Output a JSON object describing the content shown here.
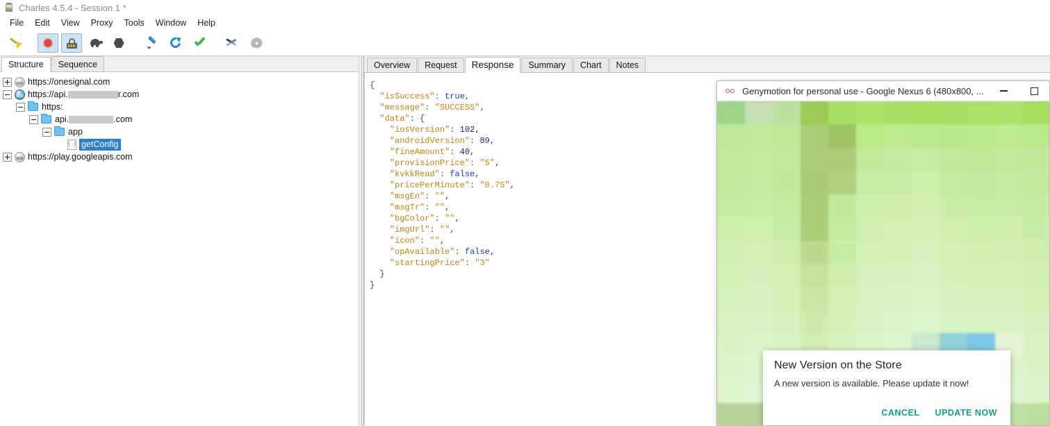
{
  "window": {
    "title": "Charles 4.5.4 - Session 1 *",
    "app_icon": "charles-jar-icon"
  },
  "menubar": {
    "items": [
      {
        "label": "File"
      },
      {
        "label": "Edit"
      },
      {
        "label": "View"
      },
      {
        "label": "Proxy"
      },
      {
        "label": "Tools"
      },
      {
        "label": "Window"
      },
      {
        "label": "Help"
      }
    ]
  },
  "toolbar": {
    "buttons": [
      {
        "name": "clear-session",
        "icon": "broom-icon",
        "active": false
      },
      {
        "name": "start-stop-recording",
        "icon": "record-icon",
        "active": true
      },
      {
        "name": "ssl-proxying",
        "icon": "lock-icon",
        "active": true
      },
      {
        "name": "throttle",
        "icon": "turtle-icon",
        "active": false
      },
      {
        "name": "breakpoints",
        "icon": "hexagon-icon",
        "active": false
      },
      {
        "name": "compose",
        "icon": "pen-icon",
        "active": false
      },
      {
        "name": "repeat",
        "icon": "refresh-icon",
        "active": false
      },
      {
        "name": "validate",
        "icon": "checkmark-icon",
        "active": false
      },
      {
        "name": "tools",
        "icon": "tools-icon",
        "active": false
      },
      {
        "name": "settings",
        "icon": "gear-icon",
        "active": false
      }
    ]
  },
  "left_pane": {
    "tabs": [
      {
        "label": "Structure",
        "active": true
      },
      {
        "label": "Sequence",
        "active": false
      }
    ],
    "tree": [
      {
        "id": "onesignal",
        "indent": 0,
        "expander": "collapsed",
        "icon": "globe-icon",
        "label": "https://onesignal.com",
        "selected": false
      },
      {
        "id": "api-host",
        "indent": 0,
        "expander": "expanded",
        "icon": "globe-blue-icon",
        "label_prefix": "https://api.",
        "redacted": true,
        "redact_width": 72,
        "label_suffix": "r.com",
        "selected": false
      },
      {
        "id": "https-folder",
        "indent": 1,
        "expander": "expanded",
        "icon": "folder-icon",
        "label": "https:",
        "selected": false
      },
      {
        "id": "api-folder",
        "indent": 2,
        "expander": "expanded",
        "icon": "folder-icon",
        "label_prefix": "api.",
        "redacted": true,
        "redact_width": 64,
        "label_suffix": ".com",
        "selected": false
      },
      {
        "id": "app-folder",
        "indent": 3,
        "expander": "expanded",
        "icon": "folder-icon",
        "label": "app",
        "selected": false
      },
      {
        "id": "getconfig",
        "indent": 4,
        "expander": "none",
        "icon": "json-file-icon",
        "label": "getConfig",
        "selected": true
      },
      {
        "id": "play-googleapis",
        "indent": 0,
        "expander": "collapsed",
        "icon": "globe-icon",
        "label": "https://play.googleapis.com",
        "selected": false
      }
    ]
  },
  "right_pane": {
    "tabs": [
      {
        "label": "Overview",
        "active": false
      },
      {
        "label": "Request",
        "active": false
      },
      {
        "label": "Response",
        "active": true
      },
      {
        "label": "Summary",
        "active": false
      },
      {
        "label": "Chart",
        "active": false
      },
      {
        "label": "Notes",
        "active": false
      }
    ],
    "response_json": [
      {
        "indent": 0,
        "parts": [
          {
            "t": "punc",
            "v": "{"
          }
        ]
      },
      {
        "indent": 1,
        "parts": [
          {
            "t": "key",
            "v": "\"isSuccess\""
          },
          {
            "t": "punc",
            "v": ": "
          },
          {
            "t": "bool",
            "v": "true"
          },
          {
            "t": "punc",
            "v": ","
          }
        ]
      },
      {
        "indent": 1,
        "parts": [
          {
            "t": "key",
            "v": "\"message\""
          },
          {
            "t": "punc",
            "v": ": "
          },
          {
            "t": "str",
            "v": "\"SUCCESS\""
          },
          {
            "t": "punc",
            "v": ","
          }
        ]
      },
      {
        "indent": 1,
        "parts": [
          {
            "t": "key",
            "v": "\"data\""
          },
          {
            "t": "punc",
            "v": ": {"
          }
        ]
      },
      {
        "indent": 2,
        "parts": [
          {
            "t": "key",
            "v": "\"iosVersion\""
          },
          {
            "t": "punc",
            "v": ": "
          },
          {
            "t": "num",
            "v": "102"
          },
          {
            "t": "punc",
            "v": ","
          }
        ]
      },
      {
        "indent": 2,
        "parts": [
          {
            "t": "key",
            "v": "\"androidVersion\""
          },
          {
            "t": "punc",
            "v": ": "
          },
          {
            "t": "num",
            "v": "89"
          },
          {
            "t": "punc",
            "v": ","
          }
        ]
      },
      {
        "indent": 2,
        "parts": [
          {
            "t": "key",
            "v": "\"fineAmount\""
          },
          {
            "t": "punc",
            "v": ": "
          },
          {
            "t": "num",
            "v": "40"
          },
          {
            "t": "punc",
            "v": ","
          }
        ]
      },
      {
        "indent": 2,
        "parts": [
          {
            "t": "key",
            "v": "\"provisionPrice\""
          },
          {
            "t": "punc",
            "v": ": "
          },
          {
            "t": "str",
            "v": "\"5\""
          },
          {
            "t": "punc",
            "v": ","
          }
        ]
      },
      {
        "indent": 2,
        "parts": [
          {
            "t": "key",
            "v": "\"kvkkRead\""
          },
          {
            "t": "punc",
            "v": ": "
          },
          {
            "t": "bool",
            "v": "false"
          },
          {
            "t": "punc",
            "v": ","
          }
        ]
      },
      {
        "indent": 2,
        "parts": [
          {
            "t": "key",
            "v": "\"pricePerMinute\""
          },
          {
            "t": "punc",
            "v": ": "
          },
          {
            "t": "str",
            "v": "\"0.75\""
          },
          {
            "t": "punc",
            "v": ","
          }
        ]
      },
      {
        "indent": 2,
        "parts": [
          {
            "t": "key",
            "v": "\"msgEn\""
          },
          {
            "t": "punc",
            "v": ": "
          },
          {
            "t": "str",
            "v": "\"\""
          },
          {
            "t": "punc",
            "v": ","
          }
        ]
      },
      {
        "indent": 2,
        "parts": [
          {
            "t": "key",
            "v": "\"msgTr\""
          },
          {
            "t": "punc",
            "v": ": "
          },
          {
            "t": "str",
            "v": "\"\""
          },
          {
            "t": "punc",
            "v": ","
          }
        ]
      },
      {
        "indent": 2,
        "parts": [
          {
            "t": "key",
            "v": "\"bgColor\""
          },
          {
            "t": "punc",
            "v": ": "
          },
          {
            "t": "str",
            "v": "\"\""
          },
          {
            "t": "punc",
            "v": ","
          }
        ]
      },
      {
        "indent": 2,
        "parts": [
          {
            "t": "key",
            "v": "\"imgUrl\""
          },
          {
            "t": "punc",
            "v": ": "
          },
          {
            "t": "str",
            "v": "\"\""
          },
          {
            "t": "punc",
            "v": ","
          }
        ]
      },
      {
        "indent": 2,
        "parts": [
          {
            "t": "key",
            "v": "\"icon\""
          },
          {
            "t": "punc",
            "v": ": "
          },
          {
            "t": "str",
            "v": "\"\""
          },
          {
            "t": "punc",
            "v": ","
          }
        ]
      },
      {
        "indent": 2,
        "parts": [
          {
            "t": "key",
            "v": "\"opAvailable\""
          },
          {
            "t": "punc",
            "v": ": "
          },
          {
            "t": "bool",
            "v": "false"
          },
          {
            "t": "punc",
            "v": ","
          }
        ]
      },
      {
        "indent": 2,
        "parts": [
          {
            "t": "key",
            "v": "\"startingPrice\""
          },
          {
            "t": "punc",
            "v": ": "
          },
          {
            "t": "str",
            "v": "\"3\""
          }
        ]
      },
      {
        "indent": 1,
        "parts": [
          {
            "t": "punc",
            "v": "}"
          }
        ]
      },
      {
        "indent": 0,
        "parts": [
          {
            "t": "punc",
            "v": "}"
          }
        ]
      }
    ]
  },
  "genymotion": {
    "title": "Genymotion for personal use - Google Nexus 6 (480x800, ...",
    "logo_icon": "genymotion-dots-icon",
    "minimize_icon": "minimize-icon",
    "maximize_icon": "maximize-icon",
    "screen_colors": [
      "#9ed389",
      "#c6e0b4",
      "#bbdfa0",
      "#9ccb55",
      "#a8e063",
      "#aae267",
      "#a9e063",
      "#a7df61",
      "#a8e063",
      "#a9e167",
      "#aae269",
      "#a6de5e",
      "#bfe89a",
      "#c2ea9d",
      "#c0e998",
      "#a9cd74",
      "#9fc466",
      "#bbe985",
      "#bfea8f",
      "#bce98a",
      "#bae888",
      "#bce98b",
      "#bfea90",
      "#bbe888",
      "#c2ea9d",
      "#c4eba0",
      "#c3eb9e",
      "#a9cd74",
      "#a9cd74",
      "#c2ea9b",
      "#c5eba2",
      "#c8eca6",
      "#c2ea9c",
      "#c0e997",
      "#c3ea9e",
      "#c1e99a",
      "#c3eb9f",
      "#c5eca2",
      "#c1e99b",
      "#a8cc73",
      "#b0d07e",
      "#c7eca5",
      "#c9eda8",
      "#cbeeab",
      "#c6eca3",
      "#c3ea9f",
      "#c5eba1",
      "#c3ea9d",
      "#c6eca3",
      "#c8eda7",
      "#c4eba0",
      "#a9cd75",
      "#c1e99b",
      "#cbeeac",
      "#cdeeaf",
      "#cfefb2",
      "#caeeaa",
      "#c7eca5",
      "#c9eda8",
      "#c6eca3",
      "#cbeeac",
      "#cdefaf",
      "#c9eda8",
      "#abce78",
      "#c5eba1",
      "#cfefb2",
      "#d1f0b5",
      "#d3f1b8",
      "#ceefb0",
      "#cbeeac",
      "#cdeeae",
      "#caeea9",
      "#cfefb3",
      "#d1f0b6",
      "#cdeeaf",
      "#bcd98e",
      "#c9eda7",
      "#d2f0b7",
      "#d4f1ba",
      "#d6f2bd",
      "#d1f0b5",
      "#cfefb2",
      "#d0efb4",
      "#cdeeae",
      "#d2f0b8",
      "#d4f1bb",
      "#d1f0b4",
      "#c6e39e",
      "#cdeeae",
      "#d5f1bc",
      "#d7f2bf",
      "#d9f3c2",
      "#d4f1ba",
      "#d2f0b7",
      "#d3f0b9",
      "#d0efb3",
      "#d5f1bd",
      "#d7f2c0",
      "#d4f1b9",
      "#cbe6a7",
      "#d1f0b3",
      "#d8f2c1",
      "#daf3c4",
      "#dcf4c7",
      "#d7f2bf",
      "#d5f1bc",
      "#d6f1be",
      "#d3f0b8",
      "#d8f2c2",
      "#daf3c5",
      "#d7f2be",
      "#cfe9ae",
      "#d4f1b8",
      "#dbf3c6",
      "#ddf4c9",
      "#dff5cc",
      "#daf3c4",
      "#d8f2c1",
      "#d9f2c3",
      "#d6f1bd",
      "#dbf3c7",
      "#ddf4ca",
      "#daf3c3",
      "#d3ebb5",
      "#d7f2bd",
      "#def4cb",
      "#e0f5ce",
      "#c8e8d0",
      "#8fd3d8",
      "#7ec8e8",
      "#e4f6d6",
      "#d9f2c2",
      "#def4cc",
      "#e0f5cf",
      "#ddf4c8",
      "#d7edbc",
      "#daf3c2",
      "#e1f5d0",
      "#e3f6d3",
      "#e5f7d6",
      "#e0f5ce",
      "#ddf4cb",
      "#dff4cd",
      "#dcf3c7",
      "#e1f5d1",
      "#e3f6d4",
      "#e0f5cd",
      "#b9d9a0",
      "#c9e5b0",
      "#e4f6d5",
      "#e6f7d8",
      "#e8f8db",
      "#e3f6d3",
      "#e0f5d0",
      "#e2f5d2",
      "#dff4cc",
      "#b5d298",
      "#b7d49b",
      "#b4d194",
      "#a98f5e",
      "#b9793d",
      "#c1e6a8",
      "#bfe4a5",
      "#bde2a2",
      "#bce0a0",
      "#bde1a1",
      "#c0e4a6",
      "#bbdf9e"
    ],
    "dialog": {
      "title": "New Version on the Store",
      "message": "A new version is available. Please update it now!",
      "cancel_label": "CANCEL",
      "update_label": "UPDATE NOW",
      "accent_color": "#0f9d96"
    }
  }
}
